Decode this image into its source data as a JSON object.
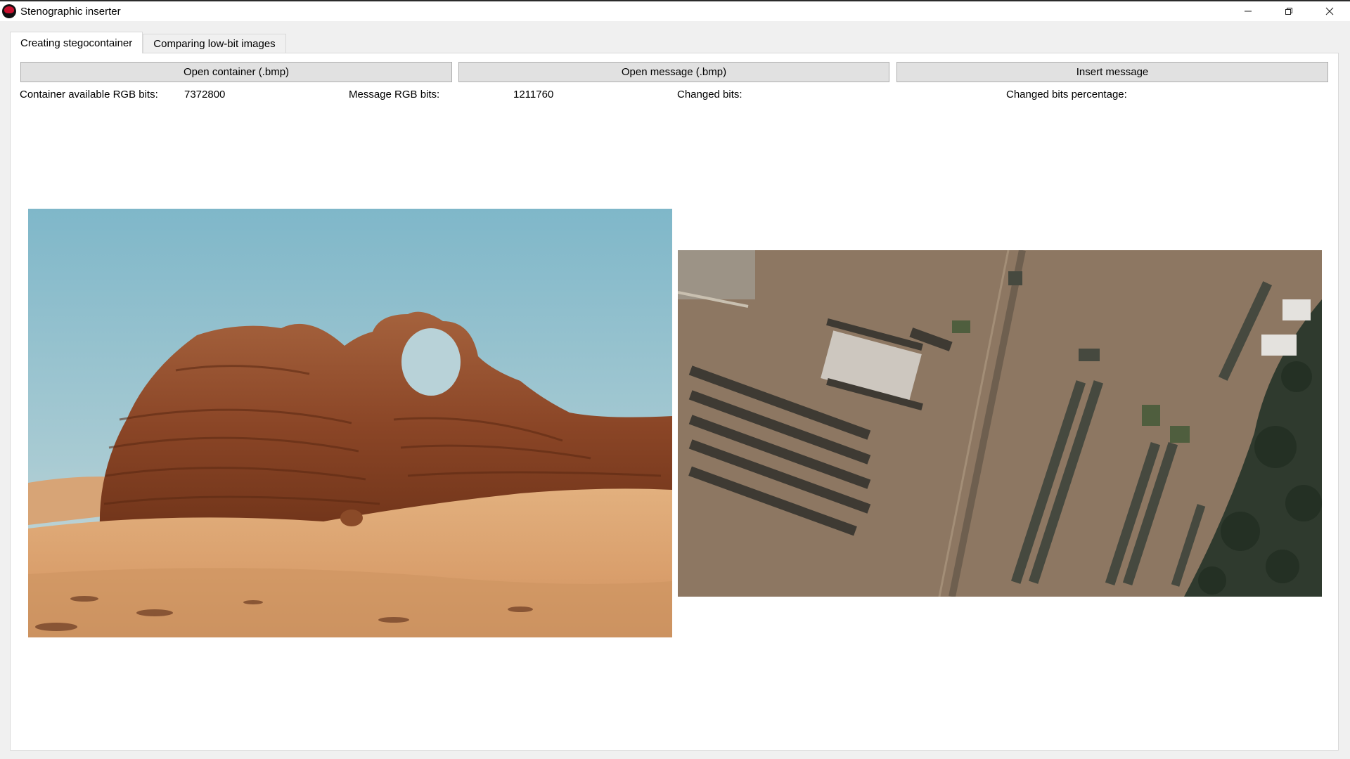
{
  "window": {
    "title": "Stenographic inserter",
    "icon": "app-icon",
    "controls": [
      "minimize-icon",
      "restore-icon",
      "close-icon"
    ]
  },
  "tabs": [
    {
      "label": "Creating stegocontainer",
      "active": true
    },
    {
      "label": "Comparing low-bit images",
      "active": false
    }
  ],
  "toolbar": {
    "open_container_label": "Open container (.bmp)",
    "open_message_label": "Open message (.bmp)",
    "insert_label": "Insert message"
  },
  "info": {
    "container_bits_label": "Container available RGB bits:",
    "container_bits_value": "7372800",
    "message_bits_label": "Message RGB bits:",
    "message_bits_value": "1211760",
    "changed_bits_label": "Changed bits:",
    "changed_bits_value": "",
    "changed_pct_label": "Changed bits percentage:",
    "changed_pct_value": ""
  },
  "images": {
    "container": "desert-rock-arch-photo",
    "message": "satellite-vehicle-yard-photo"
  },
  "colors": {
    "window_bg": "#f0f0f0",
    "panel_bg": "#ffffff",
    "button_bg": "#e1e1e1",
    "button_border": "#adadad"
  }
}
